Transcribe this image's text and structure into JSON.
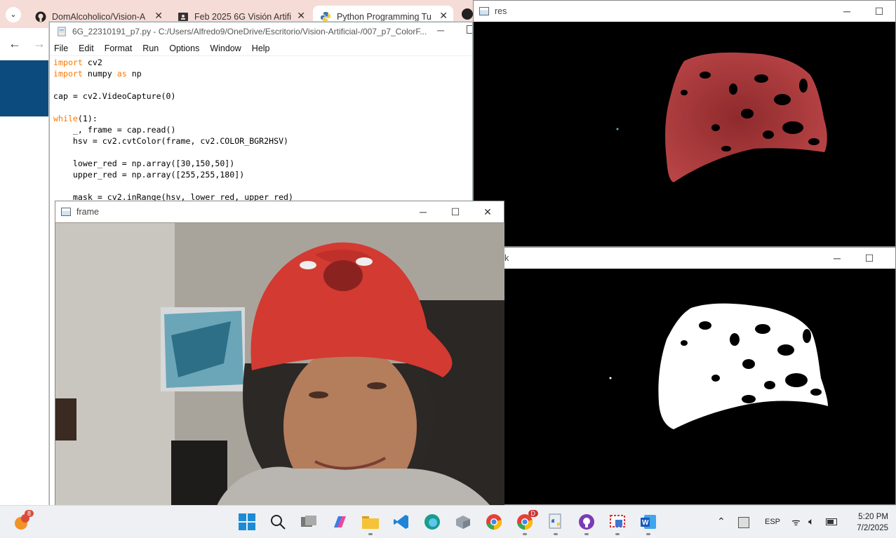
{
  "browser": {
    "tabs": [
      {
        "title": "DomAlcoholico/Vision-A",
        "icon": "github-icon"
      },
      {
        "title": "Feb 2025 6G Visión Artifi",
        "icon": "classroom-icon"
      },
      {
        "title": "Python Programming Tu",
        "icon": "python-icon",
        "active": true
      }
    ]
  },
  "idle": {
    "title": "6G_22310191_p7.py - C:/Users/Alfredo9/OneDrive/Escritorio/Vision-Artificial-/007_p7_ColorF...",
    "menu": [
      "File",
      "Edit",
      "Format",
      "Run",
      "Options",
      "Window",
      "Help"
    ],
    "code": [
      [
        {
          "k": 1,
          "t": "import"
        },
        {
          "t": " cv2"
        }
      ],
      [
        {
          "k": 1,
          "t": "import"
        },
        {
          "t": " numpy "
        },
        {
          "k": 1,
          "t": "as"
        },
        {
          "t": " np"
        }
      ],
      [
        {
          "t": ""
        }
      ],
      [
        {
          "t": "cap = cv2.VideoCapture(0)"
        }
      ],
      [
        {
          "t": ""
        }
      ],
      [
        {
          "k": 1,
          "t": "while"
        },
        {
          "t": "(1):"
        }
      ],
      [
        {
          "t": "    _, frame = cap.read()"
        }
      ],
      [
        {
          "t": "    hsv = cv2.cvtColor(frame, cv2.COLOR_BGR2HSV)"
        }
      ],
      [
        {
          "t": ""
        }
      ],
      [
        {
          "t": "    lower_red = np.array([30,150,50])"
        }
      ],
      [
        {
          "t": "    upper_red = np.array([255,255,180])"
        }
      ],
      [
        {
          "t": ""
        }
      ],
      [
        {
          "t": "    mask = cv2.inRange(hsv, lower_red, upper_red)"
        }
      ]
    ]
  },
  "windows": {
    "res_title": "res",
    "mask_title": "k",
    "frame_title": "frame"
  },
  "taskbar": {
    "weather_badge": "8",
    "chrome_badge": "D",
    "language": "ESP",
    "time": "5:20 PM",
    "date": "7/2/2025"
  }
}
